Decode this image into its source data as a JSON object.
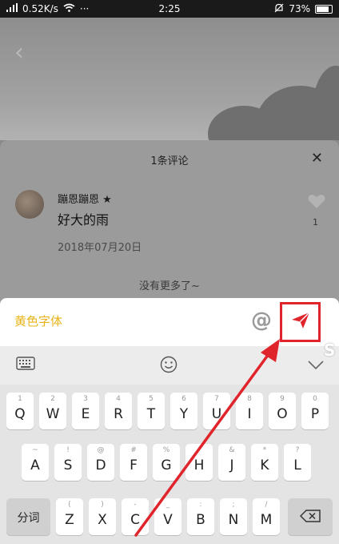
{
  "status_bar": {
    "network_speed": "0.52K/s",
    "dots": "···",
    "time": "2:25",
    "battery": "73%"
  },
  "sheet": {
    "title": "1条评论",
    "comment": {
      "author": "蹦恩蹦恩 ★",
      "text": "好大的雨",
      "date": "2018年07月20日",
      "likes": "1"
    },
    "no_more": "没有更多了~"
  },
  "input": {
    "value": "黄色字体"
  },
  "keyboard": {
    "rows": [
      [
        {
          "main": "Q",
          "sub": "1"
        },
        {
          "main": "W",
          "sub": "2"
        },
        {
          "main": "E",
          "sub": "3"
        },
        {
          "main": "R",
          "sub": "4"
        },
        {
          "main": "T",
          "sub": "5"
        },
        {
          "main": "Y",
          "sub": "6"
        },
        {
          "main": "U",
          "sub": "7"
        },
        {
          "main": "I",
          "sub": "8"
        },
        {
          "main": "O",
          "sub": "9"
        },
        {
          "main": "P",
          "sub": "0"
        }
      ],
      [
        {
          "main": "A",
          "sub": "~"
        },
        {
          "main": "S",
          "sub": "!"
        },
        {
          "main": "D",
          "sub": "@"
        },
        {
          "main": "F",
          "sub": "#"
        },
        {
          "main": "G",
          "sub": "%"
        },
        {
          "main": "H",
          "sub": "'"
        },
        {
          "main": "J",
          "sub": "&"
        },
        {
          "main": "K",
          "sub": "*"
        },
        {
          "main": "L",
          "sub": "?"
        }
      ],
      [
        {
          "main": "Z",
          "sub": "("
        },
        {
          "main": "X",
          "sub": ")"
        },
        {
          "main": "C",
          "sub": "-"
        },
        {
          "main": "V",
          "sub": "_"
        },
        {
          "main": "B",
          "sub": ":"
        },
        {
          "main": "N",
          "sub": ";"
        },
        {
          "main": "M",
          "sub": "/"
        }
      ]
    ],
    "segment_key": "分词"
  },
  "colors": {
    "accent_yellow": "#e8b41a",
    "send_red": "#e0242b",
    "highlight_box": "#e0242b"
  },
  "icons": {
    "wifi": "wifi-icon",
    "mute": "bell-off-icon",
    "battery": "battery-icon",
    "back": "chevron-left-icon",
    "close": "close-icon",
    "like": "heart-icon",
    "at": "at-icon",
    "send": "paper-plane-icon",
    "keyboard": "keyboard-icon",
    "emoji": "emoji-icon",
    "collapse": "chevron-down-icon",
    "backspace": "backspace-icon"
  }
}
